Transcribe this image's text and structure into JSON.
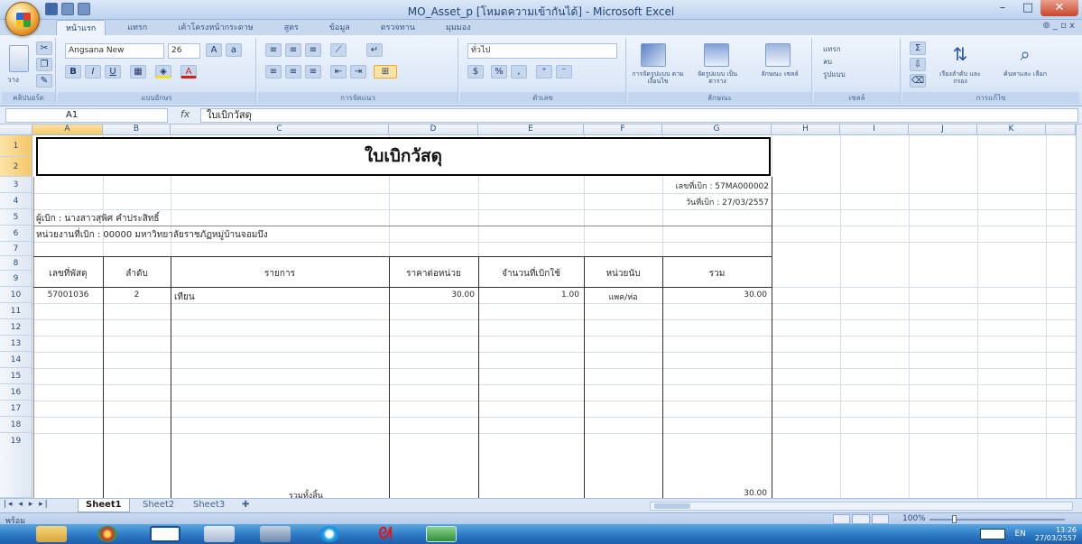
{
  "window": {
    "title": "MO_Asset_p  [โหมดความเข้ากันได้] - Microsoft Excel",
    "minimize": "–",
    "maximize": "□",
    "close": "✕"
  },
  "ribbon_tabs": [
    "หน้าแรก",
    "แทรก",
    "เค้าโครงหน้ากระดาษ",
    "สูตร",
    "ข้อมูล",
    "ตรวจทาน",
    "มุมมอง"
  ],
  "ribbon_tabs_right": "⊚ _ ▫ x",
  "ribbon": {
    "font_name": "Angsana New",
    "font_size": "26",
    "number_format": "ทั่วไป",
    "groups": {
      "clipboard": "คลิปบอร์ด",
      "font": "แบบอักษร",
      "alignment": "การจัดแนว",
      "number": "ตัวเลข",
      "styles": "ลักษณะ",
      "cells": "เซลล์",
      "editing": "การแก้ไข"
    },
    "buttons": {
      "paste": "วาง",
      "conditional": "การจัดรูปแบบ ตามเงื่อนไข",
      "format_table": "จัดรูปแบบ เป็นตาราง",
      "cell_styles": "ลักษณะ เซลล์",
      "insert": "แทรก",
      "delete": "ลบ",
      "format": "รูปแบบ",
      "sort": "เรียงลำดับ และกรอง",
      "find": "ค้นหาและ เลือก"
    }
  },
  "formula_bar": {
    "name_box": "A1",
    "fx": "fx",
    "content": "ใบเบิกวัสดุ"
  },
  "columns": [
    "A",
    "B",
    "C",
    "D",
    "E",
    "F",
    "G",
    "H",
    "I",
    "J",
    "K"
  ],
  "rows": [
    "1",
    "2",
    "3",
    "4",
    "5",
    "6",
    "7",
    "8",
    "9",
    "10",
    "11",
    "12",
    "13",
    "14",
    "15",
    "16",
    "17",
    "18",
    "19"
  ],
  "sheet": {
    "title": "ใบเบิกวัสดุ",
    "doc_no": "เลขที่เบิก : 57MA000002",
    "doc_date": "วันที่เบิก : 27/03/2557",
    "requester": "ผู้เบิก : นางสาวสุพิศ คำประสิทธิ์",
    "department": "หน่วยงานที่เบิก : 00000 มหาวิทยาลัยราชภัฏหมู่บ้านจอมบึง",
    "headers": [
      "เลขที่พัสดุ",
      "ลำดับ",
      "รายการ",
      "ราคาต่อหน่วย",
      "จำนวนที่เบิกใช้",
      "หน่วยนับ",
      "รวม"
    ],
    "rows": [
      [
        "57001036",
        "2",
        "เทียน",
        "30.00",
        "1.00",
        "แพค/ห่อ",
        "30.00"
      ]
    ],
    "footer_label": "รวมทั้งสิ้น",
    "footer_total": "30.00"
  },
  "sheet_tabs": [
    "Sheet1",
    "Sheet2",
    "Sheet3"
  ],
  "status": {
    "text": "พร้อม",
    "zoom": "100%"
  },
  "taskbar": {
    "lang": "EN",
    "time": "13:26",
    "date": "27/03/2557"
  }
}
